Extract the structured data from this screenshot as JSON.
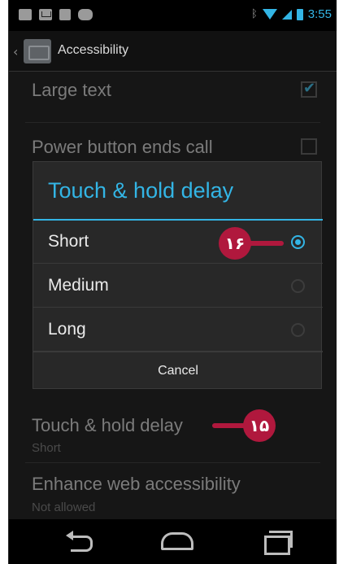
{
  "status_bar": {
    "time": "3:55",
    "left_icons": [
      "screenshot-icon",
      "mail-icon",
      "bag-icon",
      "gamepad-icon"
    ],
    "right_icons": [
      "bluetooth-icon",
      "wifi-icon",
      "signal-icon",
      "battery-icon"
    ]
  },
  "action_bar": {
    "title": "Accessibility",
    "icon": "accessibility-settings-icon"
  },
  "settings": {
    "large_text": {
      "title": "Large text",
      "checked": true
    },
    "power_button": {
      "title": "Power button ends call",
      "checked": false
    },
    "touch_hold": {
      "title": "Touch & hold delay",
      "summary": "Short"
    },
    "enhance_web": {
      "title": "Enhance web accessibility",
      "summary": "Not allowed"
    }
  },
  "dialog": {
    "title": "Touch & hold delay",
    "options": [
      {
        "label": "Short",
        "selected": true
      },
      {
        "label": "Medium",
        "selected": false
      },
      {
        "label": "Long",
        "selected": false
      }
    ],
    "cancel_label": "Cancel"
  },
  "callouts": {
    "c16": "۱۶",
    "c15": "۱۵",
    "color": "#b0183d"
  },
  "colors": {
    "accent": "#33b5e5",
    "background": "#161616",
    "dialog": "#282828"
  },
  "nav_bar": [
    "back-icon",
    "home-icon",
    "recent-apps-icon"
  ]
}
